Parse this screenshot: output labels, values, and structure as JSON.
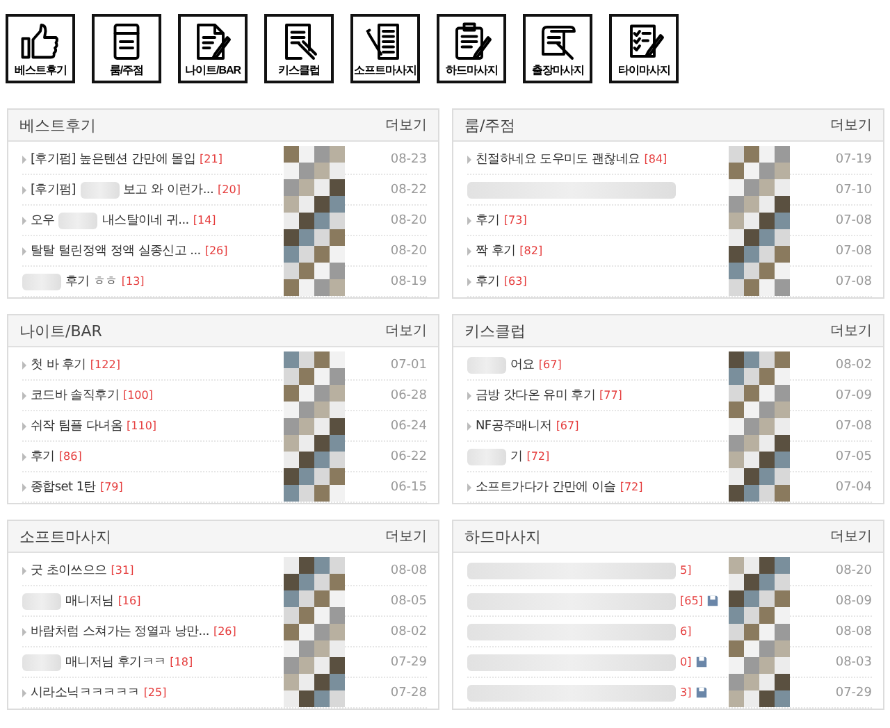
{
  "categories": [
    {
      "label": "베스트후기",
      "kind": "thumb"
    },
    {
      "label": "룸/주점",
      "kind": "book"
    },
    {
      "label": "나이트/BAR",
      "kind": "docpen"
    },
    {
      "label": "키스클럽",
      "kind": "notepen"
    },
    {
      "label": "소프트마사지",
      "kind": "paperpen"
    },
    {
      "label": "하드마사지",
      "kind": "clipboard"
    },
    {
      "label": "출장마사지",
      "kind": "scroll"
    },
    {
      "label": "타이마사지",
      "kind": "checklist"
    }
  ],
  "boards": [
    {
      "title": "베스트후기",
      "more": "더보기",
      "rows": [
        {
          "title": "[후기펌] 높은텐션 간만에 몰입",
          "count": "[21]",
          "date": "08-23",
          "blurred": false,
          "disk": false
        },
        {
          "title": "[후기펌]",
          "title_after": "보고 와 이런가...",
          "count": "[20]",
          "date": "08-22",
          "blurred": false,
          "disk": false
        },
        {
          "title": "오우",
          "title_after": "내스탈이네 귀...",
          "count": "[14]",
          "date": "08-20",
          "blurred": false,
          "disk": false
        },
        {
          "title": "탈탈 털린정액 정액 실종신고 ...",
          "count": "[26]",
          "date": "08-20",
          "blurred": false,
          "disk": false
        },
        {
          "title_after": "후기 ㅎㅎ",
          "count": "[13]",
          "date": "08-19",
          "blurred": true,
          "disk": false
        }
      ]
    },
    {
      "title": "룸/주점",
      "more": "더보기",
      "rows": [
        {
          "title": "친절하네요 도우미도 괜찮네요",
          "count": "[84]",
          "date": "07-19",
          "blurred": false,
          "disk": false
        },
        {
          "date": "07-10",
          "blurred": true,
          "disk": false
        },
        {
          "title": "후기",
          "count": "[73]",
          "date": "07-08",
          "blurred": false,
          "disk": false
        },
        {
          "title": "짝 후기",
          "count": "[82]",
          "date": "07-08",
          "blurred": false,
          "disk": false
        },
        {
          "title": "후기",
          "count": "[63]",
          "date": "07-08",
          "blurred": false,
          "disk": false
        }
      ]
    },
    {
      "title": "나이트/BAR",
      "more": "더보기",
      "rows": [
        {
          "title": "첫 바 후기",
          "count": "[122]",
          "date": "07-01",
          "blurred": false,
          "disk": false
        },
        {
          "title": "코드바 솔직후기",
          "count": "[100]",
          "date": "06-28",
          "blurred": false,
          "disk": false
        },
        {
          "title": "쉬작 팀플 다녀옴",
          "count": "[110]",
          "date": "06-24",
          "blurred": false,
          "disk": false
        },
        {
          "title": "후기",
          "count": "[86]",
          "date": "06-22",
          "blurred": false,
          "disk": false
        },
        {
          "title": "종합set 1탄",
          "count": "[79]",
          "date": "06-15",
          "blurred": false,
          "disk": false
        }
      ]
    },
    {
      "title": "키스클럽",
      "more": "더보기",
      "rows": [
        {
          "title_after": "어요",
          "count": "[67]",
          "date": "08-02",
          "blurred": true,
          "disk": false
        },
        {
          "title": "금방 갓다온 유미 후기",
          "count": "[77]",
          "date": "07-09",
          "blurred": false,
          "disk": false
        },
        {
          "title": "NF공주매니저",
          "count": "[67]",
          "date": "07-08",
          "blurred": false,
          "disk": false
        },
        {
          "title_after": "기",
          "count": "[72]",
          "date": "07-05",
          "blurred": true,
          "disk": false
        },
        {
          "title": "소프트가다가 간만에 이슬",
          "count": "[72]",
          "date": "07-04",
          "blurred": false,
          "disk": false
        }
      ]
    },
    {
      "title": "소프트마사지",
      "more": "더보기",
      "rows": [
        {
          "title": "굿 초이쓰으으",
          "count": "[31]",
          "date": "08-08",
          "blurred": false,
          "disk": false
        },
        {
          "title_after": "매니저님",
          "count": "[16]",
          "date": "08-05",
          "blurred": true,
          "disk": false
        },
        {
          "title": "바람처럼 스쳐가는 정열과 낭만...",
          "count": "[26]",
          "date": "08-02",
          "blurred": false,
          "disk": false
        },
        {
          "title_after": "매니저님 후기ㅋㅋ",
          "count": "[18]",
          "date": "07-29",
          "blurred": true,
          "disk": false
        },
        {
          "title": "시라소닉ㅋㅋㅋㅋㅋ",
          "count": "[25]",
          "date": "07-28",
          "blurred": false,
          "disk": false
        }
      ]
    },
    {
      "title": "하드마사지",
      "more": "더보기",
      "rows": [
        {
          "count": "5]",
          "date": "08-20",
          "blurred": true,
          "disk": false
        },
        {
          "count": "[65]",
          "date": "08-09",
          "blurred": true,
          "disk": true
        },
        {
          "count": "6]",
          "date": "08-08",
          "blurred": true,
          "disk": false
        },
        {
          "count": "0]",
          "date": "08-03",
          "blurred": true,
          "disk": true
        },
        {
          "count": "3]",
          "date": "07-29",
          "blurred": true,
          "disk": true
        }
      ]
    }
  ]
}
